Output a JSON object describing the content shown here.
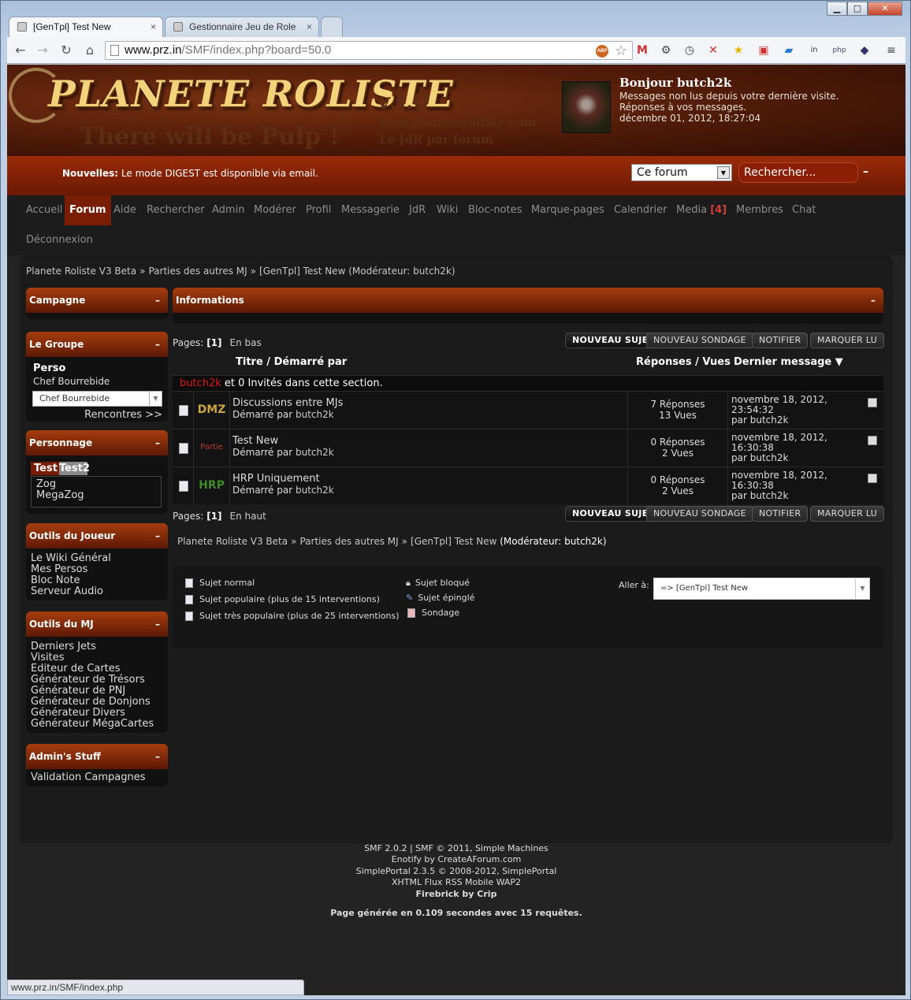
{
  "browser": {
    "tabs": [
      {
        "label": "[GenTpl] Test New",
        "active": true
      },
      {
        "label": "Gestionnaire Jeu de Role",
        "active": false
      }
    ],
    "url_host": "www.prz.in",
    "url_path": "/SMF/index.php?board=50.0",
    "status_url": "www.prz.in/SMF/index.php",
    "window_controls": {
      "min": "▁",
      "max": "□",
      "close": "✕"
    },
    "nav": {
      "back": "←",
      "forward": "→",
      "reload": "↻",
      "home": "⌂"
    }
  },
  "header": {
    "logo": "PLANETE ROLISTE",
    "version": "v3.0",
    "site_url": "www.planeteroliste.com",
    "subtitle": "Le JdR par forum",
    "tagline": "There will be Pulp !",
    "greeting": "Bonjour butch2k",
    "unread_msg": "Messages non lus depuis votre dernière visite.",
    "replies_msg": "Réponses à vos messages.",
    "datetime": "décembre 01, 2012, 18:27:04"
  },
  "newsbar": {
    "label": "Nouvelles:",
    "text": "Le mode DIGEST est disponible via email.",
    "scope": "Ce forum",
    "search_placeholder": "Rechercher...",
    "collapse": "–"
  },
  "menu": {
    "items": [
      "Accueil",
      "Forum",
      "Aide",
      "Rechercher",
      "Admin",
      "Modérer",
      "Profil",
      "Messagerie",
      "JdR",
      "Wiki",
      "Bloc-notes",
      "Marque-pages",
      "Calendrier",
      "Media",
      "Membres",
      "Chat",
      "Déconnexion"
    ],
    "active": "Forum",
    "media_badge": "[4]"
  },
  "breadcrumb": {
    "items": [
      "Planete Roliste V3 Beta",
      "Parties des autres MJ",
      "[GenTpl] Test New"
    ],
    "moderator": "(Modérateur: butch2k)"
  },
  "sidebar": {
    "campagne": {
      "title": "Campagne",
      "collapse": "–"
    },
    "groupe": {
      "title": "Le Groupe",
      "collapse": "–",
      "perso_title": "Perso",
      "perso_name": "Chef Bourrebide",
      "select_value": "Chef Bourrebide",
      "rencontres": "Rencontres >>"
    },
    "personnage": {
      "title": "Personnage",
      "collapse": "–",
      "tabs": [
        "Test",
        "Test2"
      ],
      "items": [
        "Zog",
        "MegaZog"
      ]
    },
    "outils_joueur": {
      "title": "Outils du Joueur",
      "collapse": "–",
      "items": [
        "Le Wiki Général",
        "Mes Persos",
        "Bloc Note",
        "Serveur Audio"
      ]
    },
    "outils_mj": {
      "title": "Outils du MJ",
      "collapse": "–",
      "items": [
        "Derniers Jets",
        "Visites",
        "Editeur de Cartes",
        "Générateur de Trésors",
        "Générateur de PNJ",
        "Générateur de Donjons",
        "Générateur Divers",
        "Générateur MégaCartes"
      ]
    },
    "admin": {
      "title": "Admin's Stuff",
      "collapse": "–",
      "items": [
        "Validation Campagnes"
      ]
    }
  },
  "main": {
    "info_title": "Informations",
    "info_collapse": "–",
    "pages_label": "Pages:",
    "pages_value": "[1]",
    "en_bas": "En bas",
    "en_haut": "En haut",
    "buttons": {
      "new_topic": "NOUVEAU SUJET",
      "new_poll": "NOUVEAU SONDAGE",
      "notify": "NOTIFIER",
      "mark_read": "MARQUER LU"
    },
    "headers": {
      "title": "Titre / Démarré par",
      "replies": "Réponses / Vues",
      "last": "Dernier message ▼"
    },
    "viewers": {
      "user": "butch2k",
      "rest": " et 0 Invités dans cette section."
    },
    "topics": [
      {
        "tag": "DMZ",
        "tag_color": "#c9a640",
        "title": "Discussions entre MJs",
        "started_label": "Démarré par",
        "author": "butch2k",
        "replies": "7 Réponses",
        "views": "13 Vues",
        "date": "novembre 18, 2012,",
        "time": "23:54:32",
        "by_label": "par",
        "by": "butch2k"
      },
      {
        "tag": "Partie",
        "tag_color": "#c0392b",
        "title": "Test New",
        "started_label": "Démarré par",
        "author": "butch2k",
        "replies": "0 Réponses",
        "views": "2 Vues",
        "date": "novembre 18, 2012,",
        "time": "16:30:38",
        "by_label": "par",
        "by": "butch2k"
      },
      {
        "tag": "HRP",
        "tag_color": "#3e8a2a",
        "title": "HRP Uniquement",
        "started_label": "Démarré par",
        "author": "butch2k",
        "replies": "0 Réponses",
        "views": "2 Vues",
        "date": "novembre 18, 2012,",
        "time": "16:30:38",
        "by_label": "par",
        "by": "butch2k"
      }
    ]
  },
  "legend": {
    "normal": "Sujet normal",
    "popular": "Sujet populaire (plus de 15 interventions)",
    "very_popular": "Sujet très populaire (plus de 25 interventions)",
    "locked": "Sujet bloqué",
    "sticky": "Sujet épinglé",
    "poll": "Sondage",
    "goto_label": "Aller à:",
    "goto_value": "=> [GenTpl] Test New"
  },
  "footer": {
    "line1": "SMF 2.0.2 | SMF © 2011, Simple Machines",
    "line2": "Enotify by CreateAForum.com",
    "line3": "SimplePortal 2.3.5 © 2008-2012, SimplePortal",
    "line4": "XHTML   Flux RSS   Mobile   WAP2",
    "line5": "Firebrick by Crip",
    "generated": "Page générée en 0.109 secondes avec 15 requêtes."
  }
}
